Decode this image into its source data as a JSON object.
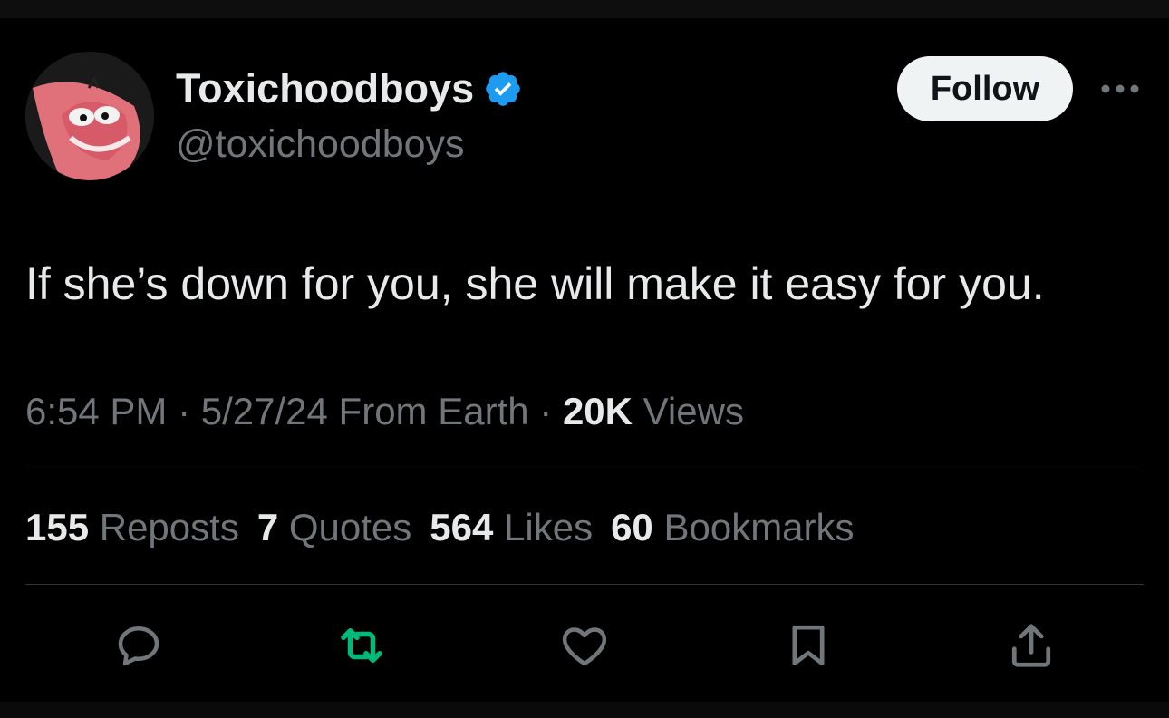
{
  "user": {
    "display_name": "Toxichoodboys",
    "handle": "@toxichoodboys",
    "verified_icon": "verified-badge-icon",
    "avatar": "avatar-image"
  },
  "header": {
    "follow_label": "Follow",
    "more_icon": "more-icon"
  },
  "tweet": {
    "text": "If she’s down for you, she will make it easy for you."
  },
  "meta": {
    "time": "6:54 PM",
    "sep1": " · ",
    "date": "5/27/24",
    "source": " From Earth",
    "sep2": " · ",
    "views_count": "20K",
    "views_label": " Views"
  },
  "stats": {
    "reposts_count": "155",
    "reposts_label": " Reposts",
    "quotes_count": "7",
    "quotes_label": " Quotes",
    "likes_count": "564",
    "likes_label": " Likes",
    "bookmarks_count": "60",
    "bookmarks_label": " Bookmarks"
  },
  "actions": {
    "reply_icon": "reply-icon",
    "repost_icon": "repost-icon",
    "like_icon": "like-icon",
    "bookmark_icon": "bookmark-icon",
    "share_icon": "share-icon"
  },
  "colors": {
    "background": "#000000",
    "text_primary": "#e7e9ea",
    "text_secondary": "#71767b",
    "verified_blue": "#1d9bf0",
    "repost_green": "#00ba7c",
    "divider": "#2f3336",
    "button_bg": "#eff3f4"
  }
}
